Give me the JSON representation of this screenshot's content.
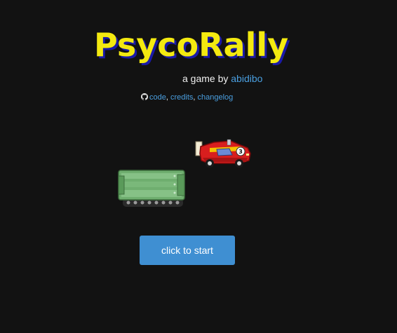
{
  "title": "PsycoRally",
  "byline": {
    "prefix": "a game by ",
    "author": "abidibo"
  },
  "links": {
    "icon": "github-icon",
    "code": "code",
    "credits": "credits",
    "changelog": "changelog",
    "separator": ", "
  },
  "sprites": {
    "car": "race-car-sprite",
    "tank": "tank-sprite"
  },
  "start_button": {
    "label": "click to start",
    "color": "#3f8fd2"
  },
  "colors": {
    "background": "#121212",
    "title": "#f4ea10",
    "title_shadow": "#1a1aa8",
    "link": "#4a9fe0"
  }
}
